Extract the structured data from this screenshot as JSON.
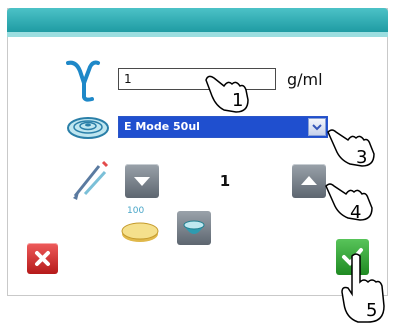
{
  "density": {
    "value": "1",
    "unit": "g/ml"
  },
  "mode": {
    "selected": "E Mode 50ul"
  },
  "step": {
    "value": "1"
  },
  "plate": {
    "label": "100"
  },
  "callouts": [
    "1",
    "3",
    "4",
    "5"
  ],
  "colors": {
    "titlebar": "#1b98a0",
    "selection": "#1f4fcf",
    "cancel": "#c62828",
    "ok": "#2e9d32"
  },
  "icons": [
    "gamma-icon",
    "coil-icon",
    "pipette-icon",
    "plate-icon",
    "bowl-icon",
    "close-icon",
    "check-icon",
    "hand-pointer-icon"
  ]
}
